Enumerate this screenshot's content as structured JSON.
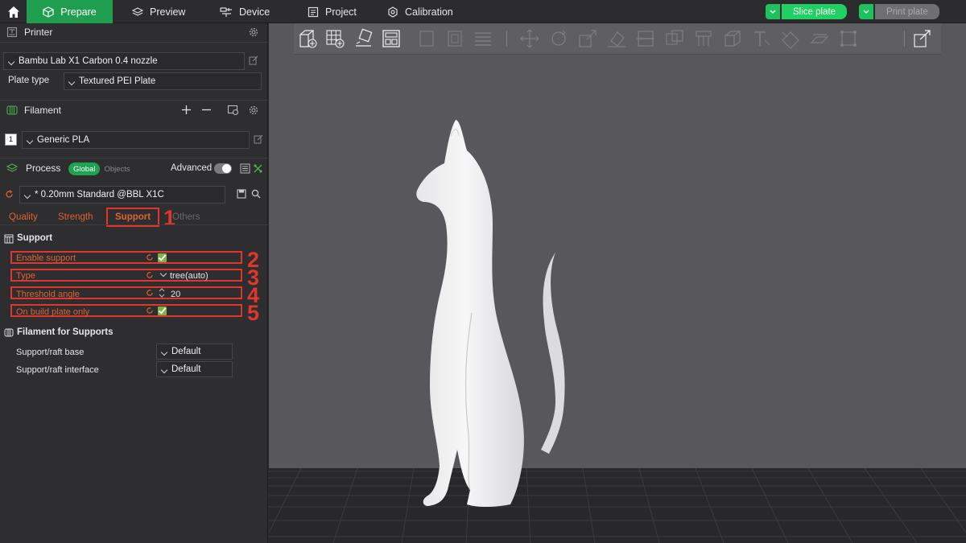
{
  "topbar": {
    "tabs": [
      {
        "label": "Prepare",
        "icon": "cube-outline-icon"
      },
      {
        "label": "Preview",
        "icon": "layers-icon"
      },
      {
        "label": "Device",
        "icon": "device-icon"
      },
      {
        "label": "Project",
        "icon": "project-icon"
      },
      {
        "label": "Calibration",
        "icon": "calibration-icon"
      }
    ],
    "slice_label": "Slice plate",
    "print_label": "Print plate"
  },
  "printer": {
    "title": "Printer",
    "name": "Bambu Lab X1 Carbon 0.4 nozzle",
    "plate_type_label": "Plate type",
    "plate_type": "Textured PEI Plate"
  },
  "filament": {
    "title": "Filament",
    "slot": "1",
    "name": "Generic PLA"
  },
  "process": {
    "title": "Process",
    "global_label": "Global",
    "objects_label": "Objects",
    "advanced_label": "Advanced",
    "preset": "* 0.20mm Standard @BBL X1C",
    "tabs": [
      "Quality",
      "Strength",
      "Support",
      "Others"
    ]
  },
  "support": {
    "title": "Support",
    "rows": [
      {
        "label": "Enable support",
        "value": ""
      },
      {
        "label": "Type",
        "value": "tree(auto)"
      },
      {
        "label": "Threshold angle",
        "value": "20"
      },
      {
        "label": "On build plate only",
        "value": ""
      }
    ]
  },
  "filament_supports": {
    "title": "Filament for Supports",
    "rows": [
      {
        "label": "Support/raft base",
        "value": "Default"
      },
      {
        "label": "Support/raft interface",
        "value": "Default"
      }
    ]
  },
  "annotations": [
    "1",
    "2",
    "3",
    "4",
    "5"
  ],
  "colors": {
    "accent_green": "#1fa352",
    "annotation_red": "#e2352b",
    "setting_orange": "#e0622f"
  }
}
